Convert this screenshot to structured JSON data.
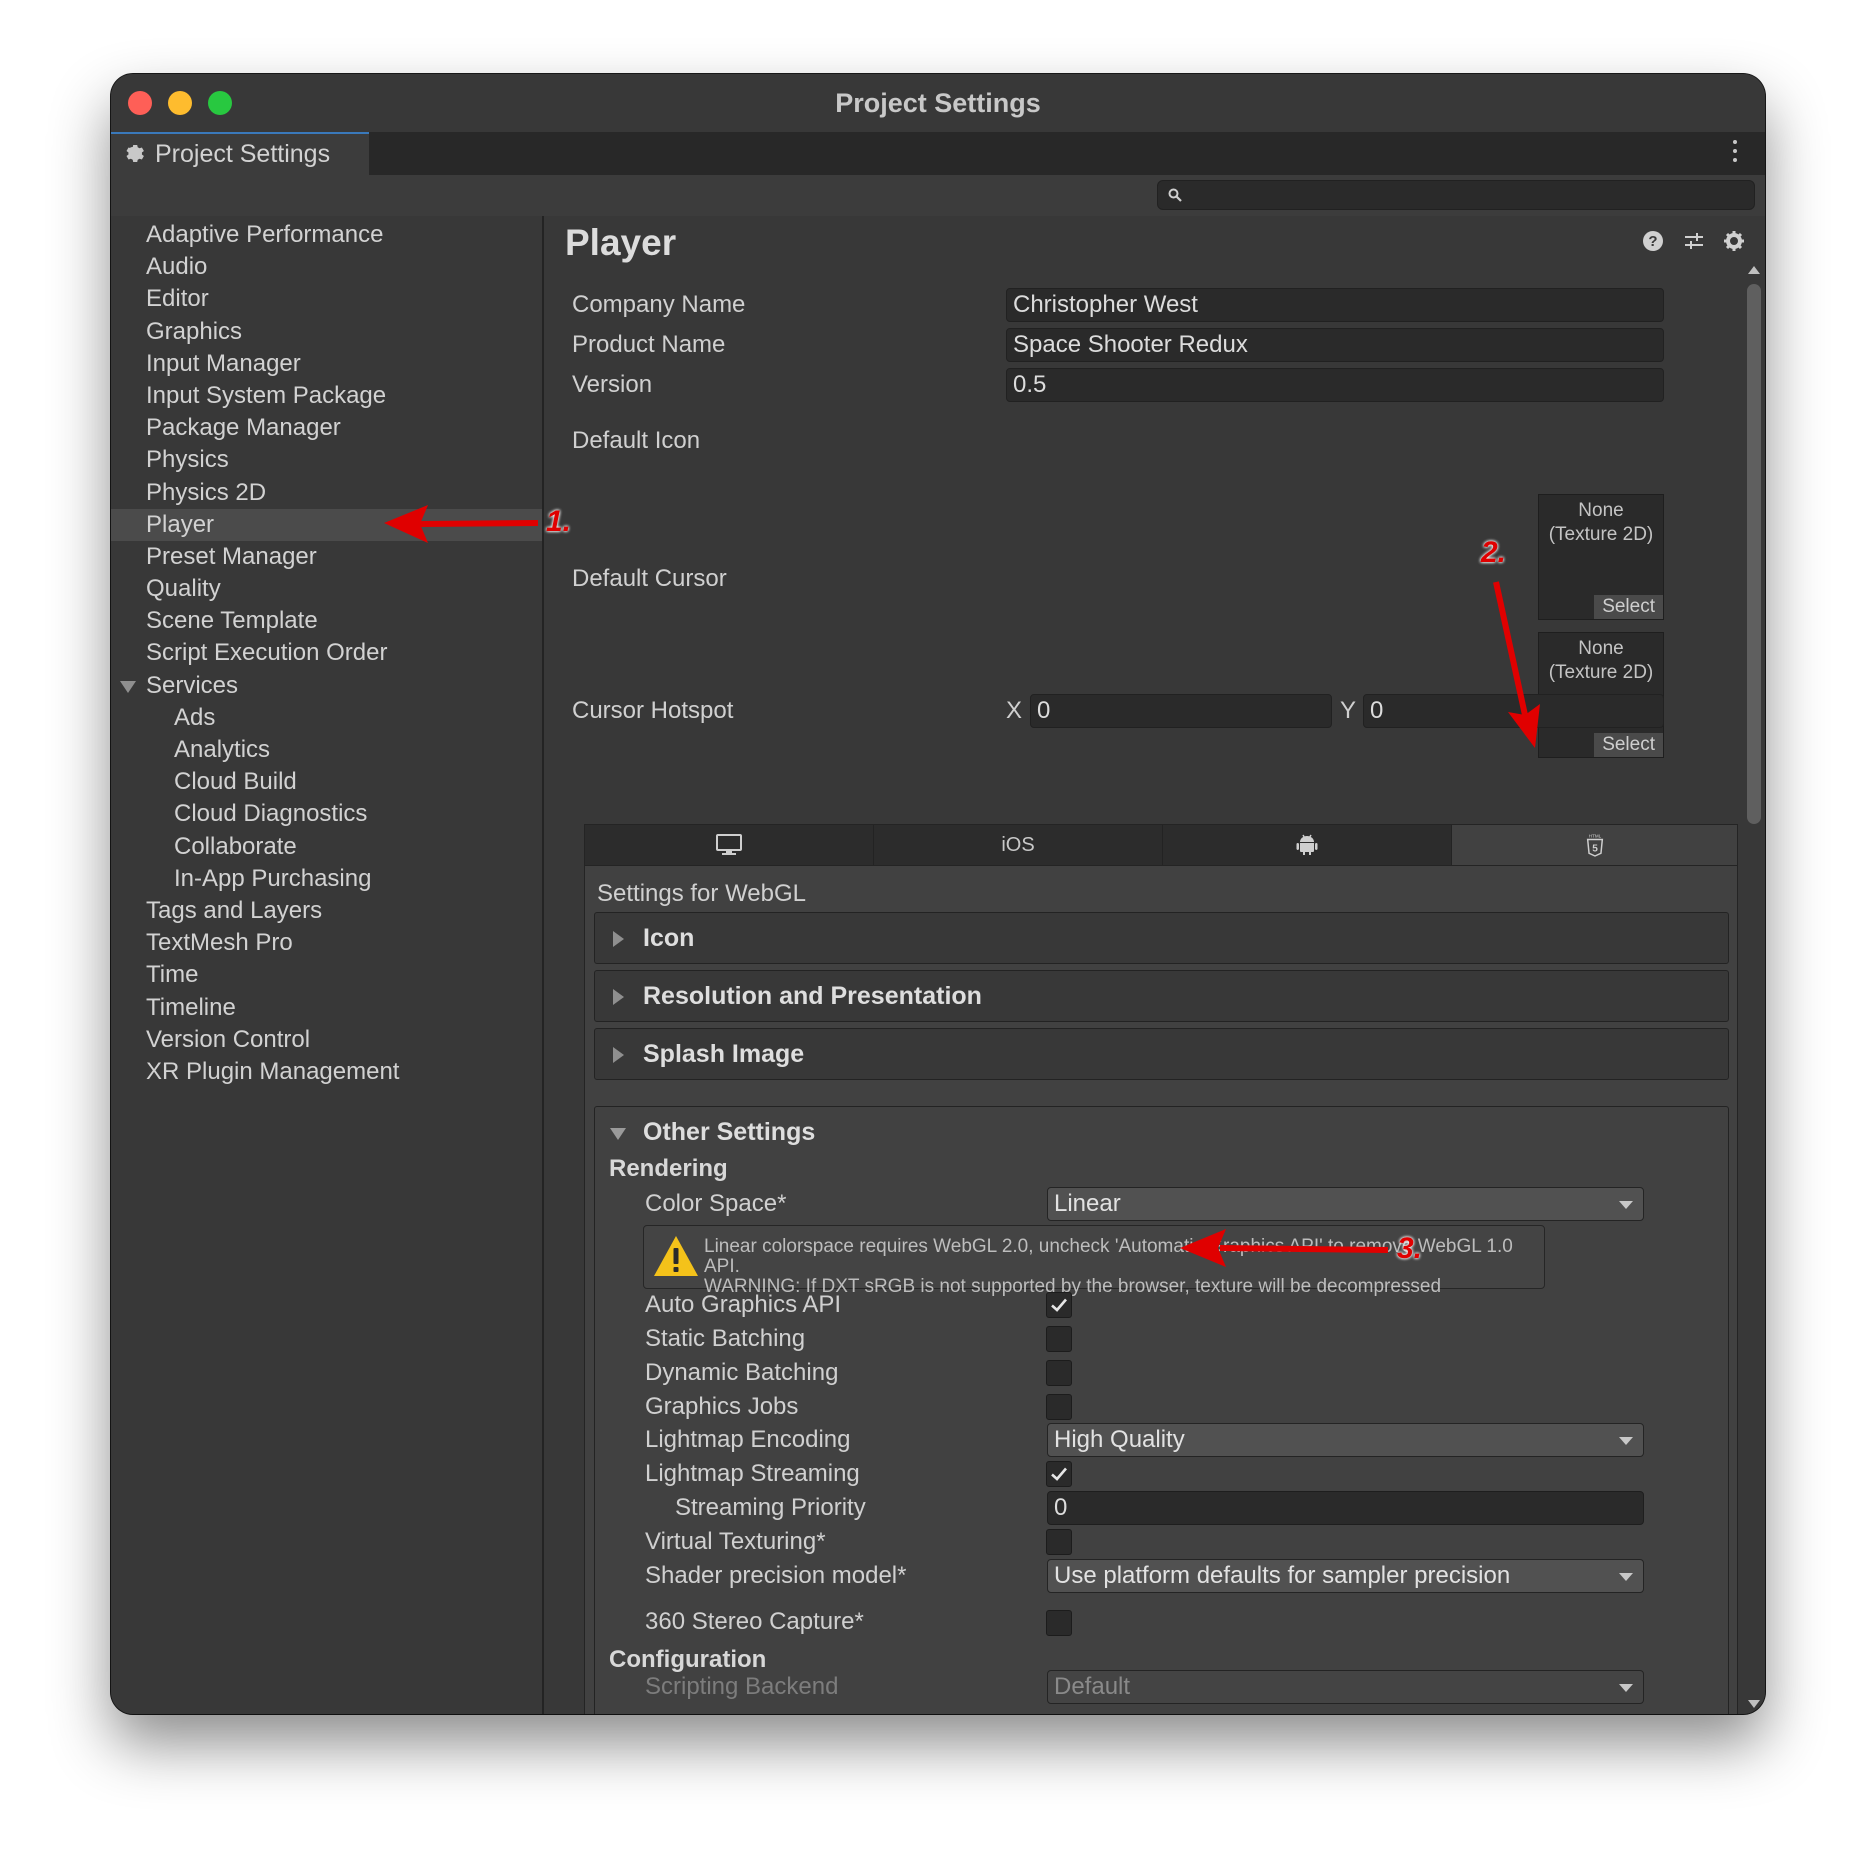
{
  "window": {
    "title": "Project Settings"
  },
  "tab": {
    "label": "Project Settings"
  },
  "search": {
    "placeholder": ""
  },
  "sidebar": {
    "items": [
      {
        "label": "Adaptive Performance"
      },
      {
        "label": "Audio"
      },
      {
        "label": "Editor"
      },
      {
        "label": "Graphics"
      },
      {
        "label": "Input Manager"
      },
      {
        "label": "Input System Package"
      },
      {
        "label": "Package Manager"
      },
      {
        "label": "Physics"
      },
      {
        "label": "Physics 2D"
      },
      {
        "label": "Player",
        "selected": true
      },
      {
        "label": "Preset Manager"
      },
      {
        "label": "Quality"
      },
      {
        "label": "Scene Template"
      },
      {
        "label": "Script Execution Order"
      },
      {
        "label": "Services",
        "expanded": true
      },
      {
        "label": "Ads",
        "indent": 1
      },
      {
        "label": "Analytics",
        "indent": 1
      },
      {
        "label": "Cloud Build",
        "indent": 1
      },
      {
        "label": "Cloud Diagnostics",
        "indent": 1
      },
      {
        "label": "Collaborate",
        "indent": 1
      },
      {
        "label": "In-App Purchasing",
        "indent": 1
      },
      {
        "label": "Tags and Layers"
      },
      {
        "label": "TextMesh Pro"
      },
      {
        "label": "Time"
      },
      {
        "label": "Timeline"
      },
      {
        "label": "Version Control"
      },
      {
        "label": "XR Plugin Management"
      }
    ]
  },
  "main": {
    "title": "Player",
    "header_icons": [
      "help-icon",
      "preset-sliders-icon",
      "gear-icon"
    ],
    "company_name": {
      "label": "Company Name",
      "value": "Christopher West"
    },
    "product_name": {
      "label": "Product Name",
      "value": "Space Shooter Redux"
    },
    "version": {
      "label": "Version",
      "value": "0.5"
    },
    "default_icon": {
      "label": "Default Icon",
      "line1": "None",
      "line2": "(Texture 2D)",
      "select": "Select"
    },
    "default_cursor": {
      "label": "Default Cursor",
      "line1": "None",
      "line2": "(Texture 2D)",
      "select": "Select"
    },
    "cursor_hotspot": {
      "label": "Cursor Hotspot",
      "x_label": "X",
      "x_value": "0",
      "y_label": "Y",
      "y_value": "0"
    },
    "platform_tabs": [
      {
        "icon": "desktop-icon",
        "label": ""
      },
      {
        "icon": "",
        "label": "iOS"
      },
      {
        "icon": "android-icon",
        "label": ""
      },
      {
        "icon": "html5-icon",
        "label": "",
        "active": true
      }
    ],
    "settings_for": "Settings for WebGL",
    "foldouts": {
      "icon": "Icon",
      "resolution": "Resolution and Presentation",
      "splash": "Splash Image",
      "other": "Other Settings"
    },
    "rendering": {
      "heading": "Rendering",
      "color_space": {
        "label": "Color Space*",
        "value": "Linear"
      },
      "warning_line1": "Linear colorspace requires WebGL 2.0, uncheck 'Automatic Graphics API' to remove WebGL 1.0 API.",
      "warning_line2": "WARNING: If DXT sRGB is not supported by the browser, texture will be decompressed",
      "auto_graphics_api": {
        "label": "Auto Graphics API",
        "checked": true
      },
      "static_batching": {
        "label": "Static Batching",
        "checked": false
      },
      "dynamic_batching": {
        "label": "Dynamic Batching",
        "checked": false
      },
      "graphics_jobs": {
        "label": "Graphics Jobs",
        "checked": false
      },
      "lightmap_encoding": {
        "label": "Lightmap Encoding",
        "value": "High Quality"
      },
      "lightmap_streaming": {
        "label": "Lightmap Streaming",
        "checked": true
      },
      "streaming_priority": {
        "label": "Streaming Priority",
        "value": "0"
      },
      "virtual_texturing": {
        "label": "Virtual Texturing*",
        "checked": false
      },
      "shader_precision": {
        "label": "Shader precision model*",
        "value": "Use platform defaults for sampler precision"
      },
      "stereo_capture": {
        "label": "360 Stereo Capture*",
        "checked": false
      }
    },
    "configuration": {
      "heading": "Configuration",
      "scripting_backend": {
        "label": "Scripting Backend",
        "value": "Default"
      }
    }
  },
  "annotations": {
    "a1": "1.",
    "a2": "2.",
    "a3": "3.",
    "color": "#e00000"
  }
}
